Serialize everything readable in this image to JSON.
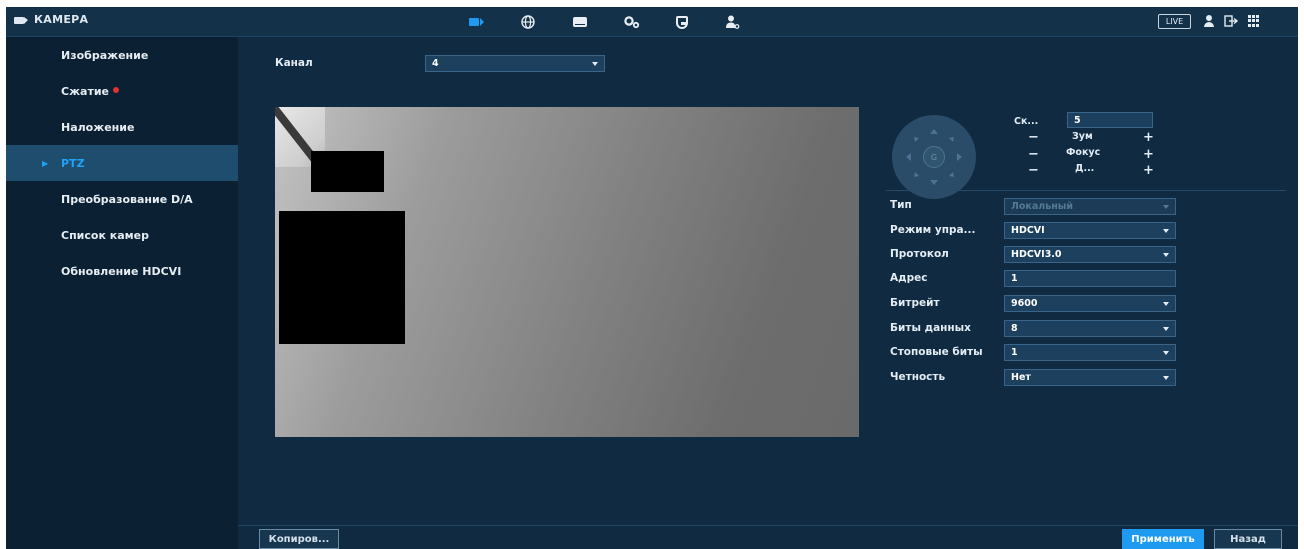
{
  "header": {
    "title": "КАМЕРА",
    "nav_icons": [
      "camera-icon",
      "network-icon",
      "storage-icon",
      "system-icon",
      "security-icon",
      "account-icon"
    ],
    "live_label": "LIVE"
  },
  "sidebar": {
    "items": [
      {
        "label": "Изображение",
        "active": false
      },
      {
        "label": "Сжатие",
        "active": false,
        "alert": true
      },
      {
        "label": "Наложение",
        "active": false
      },
      {
        "label": "PTZ",
        "active": true
      },
      {
        "label": "Преобразование D/A",
        "active": false
      },
      {
        "label": "Список камер",
        "active": false
      },
      {
        "label": "Обновление HDCVI",
        "active": false
      }
    ]
  },
  "main": {
    "channel_label": "Канал",
    "channel_value": "4",
    "ptz": {
      "speed_label": "Ск...",
      "speed_value": "5",
      "zoom_label": "Зум",
      "focus_label": "Фокус",
      "iris_label": "Д...",
      "minus": "−",
      "plus": "+"
    },
    "form": {
      "type_label": "Тип",
      "type_value": "Локальный",
      "control_mode_label": "Режим упра...",
      "control_mode_value": "HDCVI",
      "protocol_label": "Протокол",
      "protocol_value": "HDCVI3.0",
      "address_label": "Адрес",
      "address_value": "1",
      "baudrate_label": "Битрейт",
      "baudrate_value": "9600",
      "databits_label": "Биты данных",
      "databits_value": "8",
      "stopbits_label": "Стоповые биты",
      "stopbits_value": "1",
      "parity_label": "Четность",
      "parity_value": "Нет"
    },
    "buttons": {
      "copy": "Копиров...",
      "apply": "Применить",
      "back": "Назад"
    }
  },
  "colors": {
    "accent": "#1e9bf0",
    "background": "#0f2a41",
    "sidebar": "#0b2032",
    "active_item": "#1f4d6e"
  }
}
